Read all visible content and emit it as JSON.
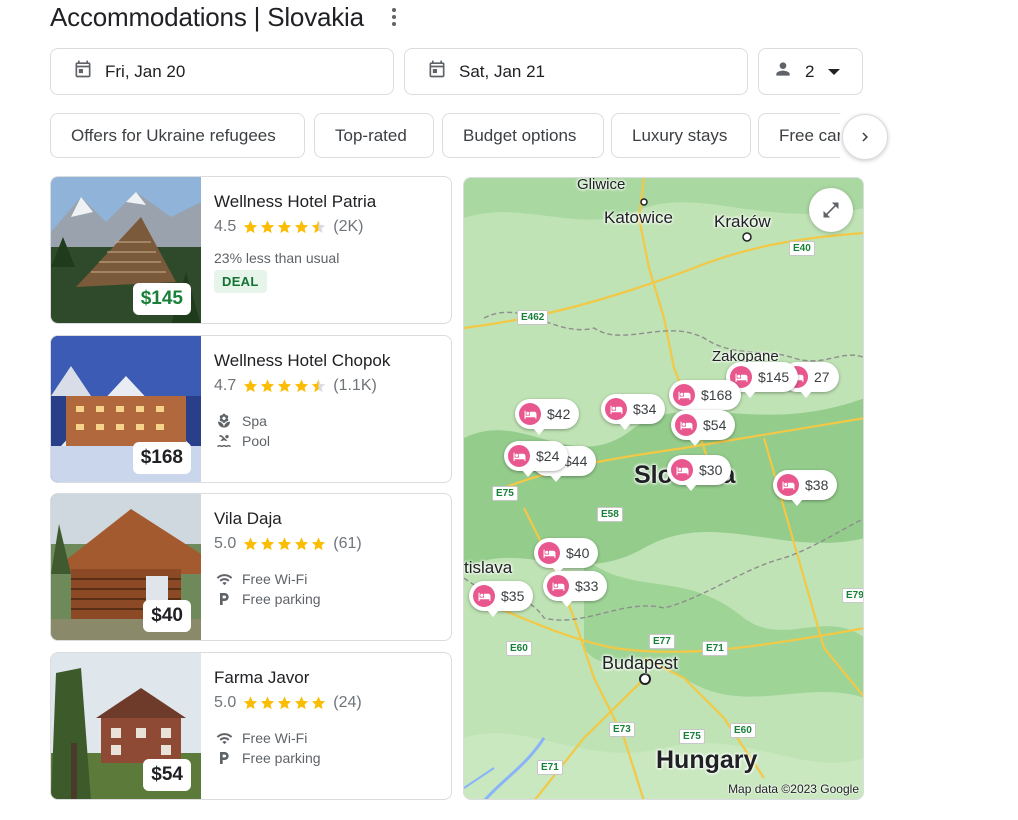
{
  "header": {
    "title": "Accommodations | Slovakia"
  },
  "search": {
    "check_in": "Fri, Jan 20",
    "check_out": "Sat, Jan 21",
    "guests": "2"
  },
  "filters": [
    "Offers for Ukraine refugees",
    "Top-rated",
    "Budget options",
    "Luxury stays",
    "Free cancellation"
  ],
  "hotels": [
    {
      "name": "Wellness Hotel Patria",
      "rating": "4.5",
      "stars": 4.5,
      "reviews": "(2K)",
      "price": "$145",
      "note": "23% less than usual",
      "badge": "DEAL",
      "amenities": []
    },
    {
      "name": "Wellness Hotel Chopok",
      "rating": "4.7",
      "stars": 4.5,
      "reviews": "(1.1K)",
      "price": "$168",
      "amenities": [
        {
          "icon": "spa-icon",
          "label": "Spa"
        },
        {
          "icon": "pool-icon",
          "label": "Pool"
        }
      ]
    },
    {
      "name": "Vila Daja",
      "rating": "5.0",
      "stars": 5,
      "reviews": "(61)",
      "price": "$40",
      "amenities": [
        {
          "icon": "wifi-icon",
          "label": "Free Wi-Fi"
        },
        {
          "icon": "parking-icon",
          "label": "Free parking"
        }
      ]
    },
    {
      "name": "Farma Javor",
      "rating": "5.0",
      "stars": 5,
      "reviews": "(24)",
      "price": "$54",
      "amenities": [
        {
          "icon": "wifi-icon",
          "label": "Free Wi-Fi"
        },
        {
          "icon": "parking-icon",
          "label": "Free parking"
        }
      ]
    }
  ],
  "map": {
    "cities": [
      "Gliwice",
      "Katowice",
      "Kraków",
      "Zakopane",
      "Slovakia",
      "tislava",
      "Budapest",
      "Hungary"
    ],
    "roads": [
      "E40",
      "E462",
      "E75",
      "E58",
      "E77",
      "E71",
      "E79",
      "E60",
      "E73",
      "E75",
      "E60",
      "E71"
    ],
    "pins": [
      "$145",
      "27",
      "$168",
      "$42",
      "$34",
      "$54",
      "$24",
      "$44",
      "$30",
      "$38",
      "$40",
      "$33",
      "$35"
    ],
    "credit": "Map data ©2023 Google"
  },
  "colors": {
    "accent_blue": "#1a73e8",
    "deal_green": "#188038",
    "pin_pink": "#e8588f",
    "star_gold": "#fbbc04",
    "map_green": "#a6d6a4"
  }
}
